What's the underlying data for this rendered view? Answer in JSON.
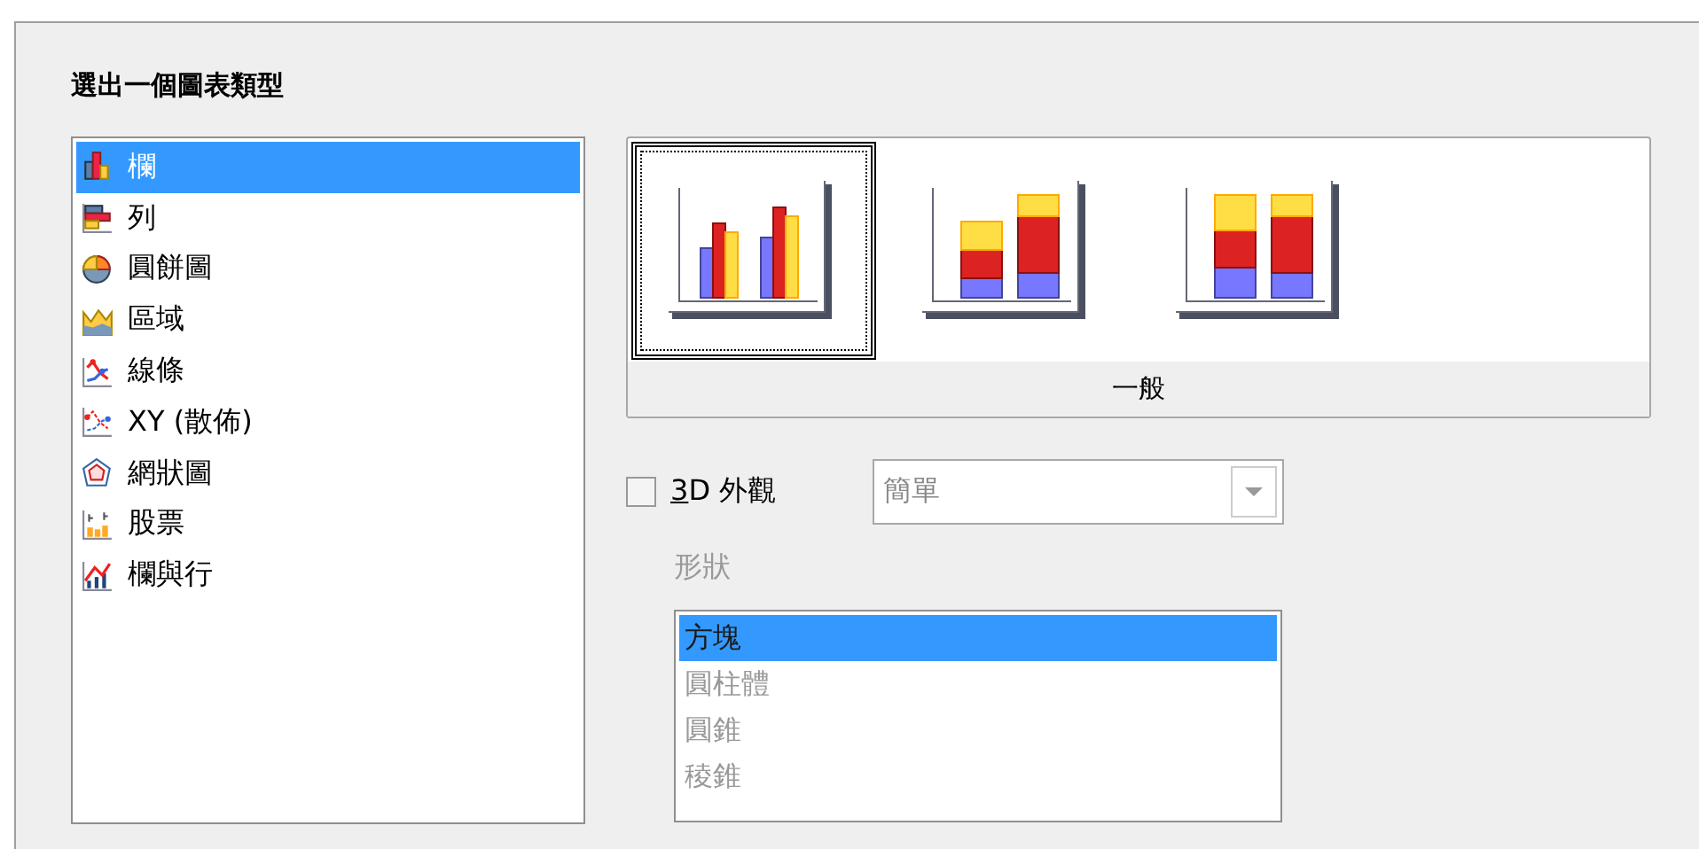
{
  "title": "選出一個圖表類型",
  "chart_types": [
    {
      "label": "欄",
      "kind": "column",
      "selected": true
    },
    {
      "label": "列",
      "kind": "bar",
      "selected": false
    },
    {
      "label": "圓餅圖",
      "kind": "pie",
      "selected": false
    },
    {
      "label": "區域",
      "kind": "area",
      "selected": false
    },
    {
      "label": "線條",
      "kind": "line",
      "selected": false
    },
    {
      "label": "XY (散佈)",
      "kind": "xy",
      "selected": false
    },
    {
      "label": "網狀圖",
      "kind": "net",
      "selected": false
    },
    {
      "label": "股票",
      "kind": "stock",
      "selected": false
    },
    {
      "label": "欄與行",
      "kind": "combo",
      "selected": false
    }
  ],
  "variants": {
    "items": [
      {
        "kind": "normal",
        "selected": true
      },
      {
        "kind": "stacked",
        "selected": false
      },
      {
        "kind": "percent",
        "selected": false
      }
    ],
    "caption": "一般"
  },
  "three_d": {
    "label": "3D 外觀",
    "checked": false
  },
  "scheme_dropdown": {
    "value": "簡單",
    "disabled": true
  },
  "shape": {
    "label": "形狀",
    "disabled": true,
    "items": [
      {
        "label": "方塊",
        "selected": true
      },
      {
        "label": "圓柱體",
        "selected": false
      },
      {
        "label": "圓錐",
        "selected": false
      },
      {
        "label": "稜錐",
        "selected": false
      }
    ]
  }
}
